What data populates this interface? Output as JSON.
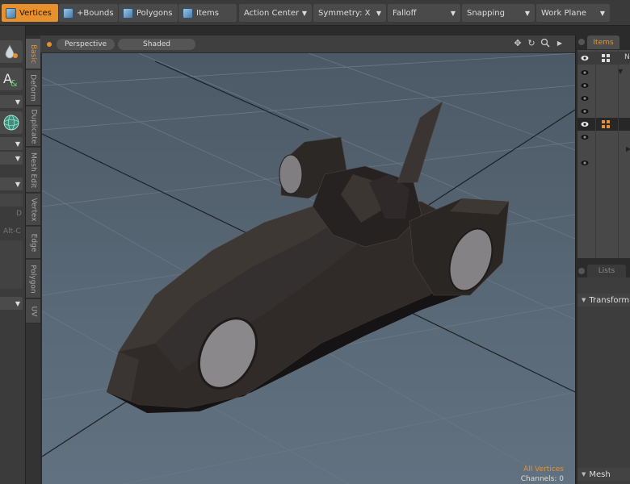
{
  "toolbar": {
    "modes": [
      {
        "label": "Vertices",
        "icon": "vertices-mode-icon",
        "active": true
      },
      {
        "label": "+Bounds",
        "icon": "bounds-mode-icon",
        "active": false
      },
      {
        "label": "Polygons",
        "icon": "polygons-mode-icon",
        "active": false
      },
      {
        "label": "Items",
        "icon": "items-mode-icon",
        "active": false
      }
    ],
    "dropdowns": [
      "Action Center",
      "Symmetry: X",
      "Falloff",
      "Snapping",
      "Work Plane"
    ]
  },
  "left_toolbar": {
    "text_a": "D",
    "text_b": "Alt-C"
  },
  "vertical_tabs": [
    "Basic",
    "Deform",
    "Duplicate",
    "Mesh Edit",
    "Vertex",
    "Edge",
    "Polygon",
    "UV"
  ],
  "viewport": {
    "view_mode": "Perspective",
    "shading": "Shaded",
    "info_line1": "All Vertices",
    "info_line2": "Channels: 0"
  },
  "right_panel": {
    "items_tab": "Items",
    "lists_tab": "Lists",
    "sections": [
      "Transform",
      "Mesh"
    ],
    "col_header": "N"
  },
  "colors": {
    "accent": "#e8902c",
    "viewport_bg": "#55636f",
    "model": "#2f2b29",
    "wheel": "#8a888a"
  }
}
